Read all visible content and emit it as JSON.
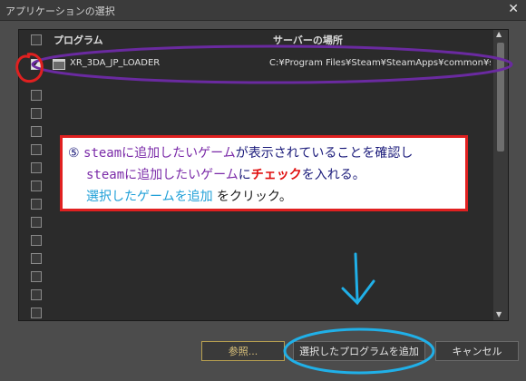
{
  "window": {
    "title": "アプリケーションの選択",
    "close_glyph": "✕"
  },
  "table": {
    "header": {
      "program": "プログラム",
      "location": "サーバーの場所"
    },
    "rows": [
      {
        "name": "XR_3DA_JP_LOADER",
        "path": "C:¥Program Files¥Steam¥SteamApps¥common¥sta",
        "checked": true
      }
    ]
  },
  "note": {
    "line1_num": "⑤",
    "line1_a": "steam",
    "line1_b": "に追加したいゲーム",
    "line1_c": "が表示されていることを確認し",
    "line2_a": "steam",
    "line2_b": "に追加したいゲーム",
    "line2_c": "に",
    "line2_d": "チェック",
    "line2_e": "を入れる。",
    "line3_a": "選択したゲームを追加",
    "line3_b": "をクリック。"
  },
  "buttons": {
    "browse": "参照...",
    "add_selected": "選択したプログラムを追加",
    "cancel": "キャンセル"
  },
  "colors": {
    "annotation_purple": "#6a2aa0",
    "annotation_red": "#e02020",
    "annotation_cyan": "#20b0e8"
  },
  "icons": {
    "checkmark": "✔",
    "scroll_up": "▲",
    "scroll_down": "▼"
  }
}
